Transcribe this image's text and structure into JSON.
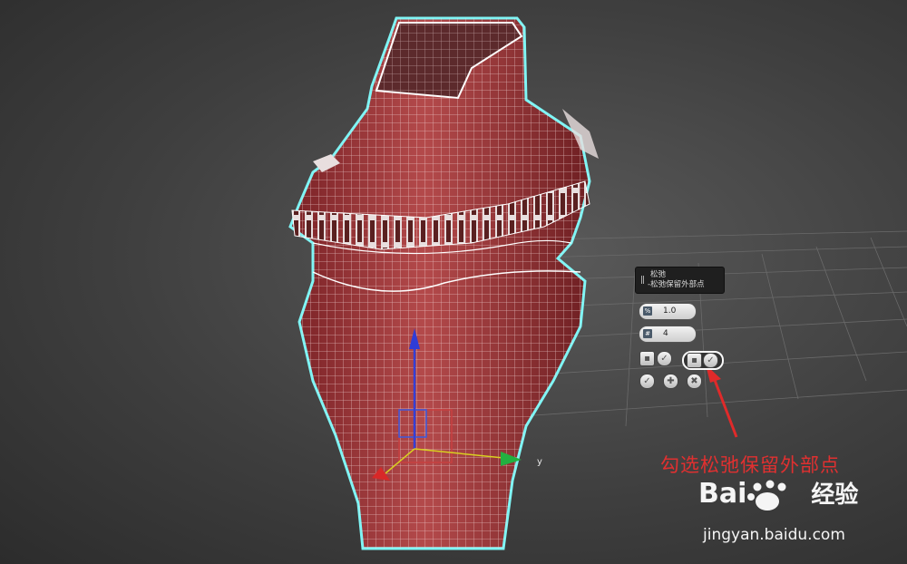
{
  "caddy": {
    "title": "松弛",
    "subtitle": "-松弛保留外部点",
    "amount_value": "1.0",
    "iterations_value": "4",
    "icons": [
      "amount-icon",
      "iterations-icon",
      "relax-boundary-icon",
      "save-outer-corners-icon",
      "ok-icon",
      "apply-icon",
      "cancel-icon"
    ]
  },
  "annotation": {
    "text": "勾选松弛保留外部点",
    "color": "#e03030"
  },
  "watermark": {
    "brand_left": "Bai",
    "brand_right": "经验",
    "url": "jingyan.baidu.com"
  },
  "gizmo": {
    "y_label": "y"
  },
  "colors": {
    "mesh": "#a8383a",
    "selection_outline": "#7ff5f5",
    "wire": "#ffffff"
  }
}
